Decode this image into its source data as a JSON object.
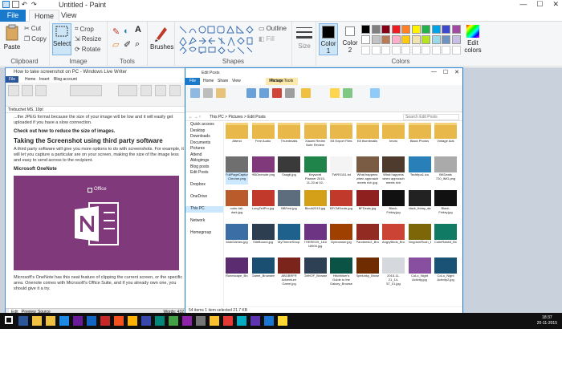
{
  "paint": {
    "title": "Untitled - Paint",
    "tabs": {
      "file": "File",
      "home": "Home",
      "view": "View"
    },
    "clipboard": {
      "paste": "Paste",
      "cut": "Cut",
      "copy": "Copy",
      "label": "Clipboard"
    },
    "image": {
      "select": "Select",
      "crop": "Crop",
      "resize": "Resize",
      "rotate": "Rotate",
      "label": "Image"
    },
    "tools": {
      "label": "Tools",
      "text_glyph": "A"
    },
    "brushes": {
      "label": "Brushes"
    },
    "shapes": {
      "outline": "Outline",
      "fill": "Fill",
      "label": "Shapes"
    },
    "size": {
      "label": "Size"
    },
    "colors": {
      "color1": "Color 1",
      "color2": "Color 2",
      "label": "Colors",
      "edit": "Edit colors",
      "palette": [
        "#000000",
        "#7f7f7f",
        "#880015",
        "#ed1c24",
        "#ff7f27",
        "#fff200",
        "#22b14c",
        "#00a2e8",
        "#3f48cc",
        "#a349a4",
        "#ffffff",
        "#c3c3c3",
        "#b97a57",
        "#ffaec9",
        "#ffc90e",
        "#efe4b0",
        "#b5e61d",
        "#99d9ea",
        "#7092be",
        "#c8bfe7"
      ]
    }
  },
  "doc": {
    "title": "How to take screenshot on PC - Windows Live Writer",
    "tabs": {
      "file": "File",
      "home": "Home",
      "insert": "Insert",
      "blog": "Blog account"
    },
    "font_bar": "Trebuchet MS, 10pt",
    "para1": "...the JPEG format because the size of your image will be low and it will easily get uploaded if you have a slow connection.",
    "link": "Check out how to reduce the size of images.",
    "heading": "Taking the Screenshot using third party software",
    "para2": "A third party software will give you more options to do with screenshots. For example, it will let you capture a particular are on your screen, making the size of the image less and easy to send across to the recipient.",
    "subheading": "Microsoft OneNote",
    "office_logo": "Office",
    "para3": "Microsoft's OneNote has this neat feature of clipping the current screen, or the specific area. Onenote comes with Microsoft's Office Suite, and if you already own one, you should give it a try.",
    "status_tabs": [
      "Edit",
      "Preview",
      "Source"
    ],
    "words": "Words: 432"
  },
  "explorer": {
    "title": "Edit Posts",
    "tabs": {
      "file": "File",
      "home": "Home",
      "share": "Share",
      "view": "View",
      "manage": "Manage",
      "picture_tools": "Picture Tools"
    },
    "address": "This PC  >  Pictures  >  Edit Posts",
    "search": "Search Edit Posts",
    "nav": [
      "Quick access",
      "Desktop",
      "Downloads",
      "Documents",
      "Pictures",
      "Attend",
      "Ablogimgs",
      "Blog posts",
      "Edit Posts",
      "",
      "Dropbox",
      "",
      "OneDrive",
      "",
      "This PC",
      "",
      "Network",
      "",
      "Homegroup"
    ],
    "items": [
      {
        "label": "Attend",
        "color": "#e9b84a"
      },
      {
        "label": "Free Audio",
        "color": "#e9b84a"
      },
      {
        "label": "Thumbnails",
        "color": "#e9b84a"
      },
      {
        "label": "Xiaomi Redmi Note Review",
        "color": "#e9b84a"
      },
      {
        "label": "E8 Export Files",
        "color": "#e9b84a"
      },
      {
        "label": "E8 thumbnails",
        "color": "#e9b84a"
      },
      {
        "label": "Imoto",
        "color": "#e9b84a"
      },
      {
        "label": "Black Photos",
        "color": "#e9b84a"
      },
      {
        "label": "Vintage Ads",
        "color": "#e9b84a"
      },
      {
        "label": "FullPageCapture Chrome.png",
        "color": "#6f6f6f"
      },
      {
        "label": "HBOnenote.png",
        "color": "#80397b"
      },
      {
        "label": "Snagit.jpg",
        "color": "#3a3a3a"
      },
      {
        "label": "Keyword Planner 2015-11-20 at 02-26.csv",
        "color": "#1e8449"
      },
      {
        "label": "TWRS151.txt",
        "color": "#f4f4f4"
      },
      {
        "label": "What happens when approach meets rich.jpg",
        "color": "#7a5c44"
      },
      {
        "label": "What happens when approach meets rich 2.jpg",
        "color": "#4f3a2e"
      },
      {
        "label": "Techtipa1.ico",
        "color": "#2980b9"
      },
      {
        "label": "BKDeals 720_IMG.png",
        "color": "#aaaaaa"
      },
      {
        "label": "outer-fall-dark.jpg",
        "color": "#b95b2b"
      },
      {
        "label": "LongTellPro.jpg",
        "color": "#c0392b"
      },
      {
        "label": "BBFest.jpg",
        "color": "#5d6d7e"
      },
      {
        "label": "Bloob2015.jpg",
        "color": "#d4a017"
      },
      {
        "label": "BFCMDeals.jpg",
        "color": "#c0392b"
      },
      {
        "label": "BFDeals.jpg",
        "color": "#8e2020"
      },
      {
        "label": "Black-Friday.jpg",
        "color": "#111111"
      },
      {
        "label": "black_friday_deals.jpg",
        "color": "#222222"
      },
      {
        "label": "Black-Friday.jpg",
        "color": "#111111"
      },
      {
        "label": "MobGames.jpg",
        "color": "#3b6ea5"
      },
      {
        "label": "SiteBound.jpg",
        "color": "#2c3e50"
      },
      {
        "label": "MyThemeShop.jpg",
        "color": "#1f618d"
      },
      {
        "label": "THEREG5_16160 18905.jpg",
        "color": "#6c3483"
      },
      {
        "label": "Dpbrowser.jpg",
        "color": "#a04000"
      },
      {
        "label": "Pandemic2_BrowserGame.jpg",
        "color": "#922b21"
      },
      {
        "label": "AngryBirds_BrowserGame.jpg",
        "color": "#cb4335"
      },
      {
        "label": "KingdomRush_BrowserGame.jpg",
        "color": "#7d6608"
      },
      {
        "label": "CutieRabbit_BrowserGame_Featured.jpg",
        "color": "#117a65"
      },
      {
        "label": "Runescape_BrowserGame.jpg",
        "color": "#5b2c6f"
      },
      {
        "label": "Game_BrowserGame.jpg",
        "color": "#1b4f72"
      },
      {
        "label": "ABGBRFR Adventure Game.jpg",
        "color": "#7b241c"
      },
      {
        "label": "GitHOF_BrowserGame.png",
        "color": "#2e4053"
      },
      {
        "label": "Hitchhiker's Guide to the Galaxy_BrowserGame.png",
        "color": "#0b5345"
      },
      {
        "label": "Spelunky_BrowserGame.jpg",
        "color": "#6e2c00"
      },
      {
        "label": "2015-11-21_14-57_01.jpg",
        "color": "#d5d8dc"
      },
      {
        "label": "CoLo_Night Activity.jpg",
        "color": "#884ea0"
      },
      {
        "label": "CoLo_Night Activity2.jpg",
        "color": "#1a5276"
      }
    ],
    "status": "54 items    1 item selected  21.7 KB"
  },
  "taskbar": {
    "icons": [
      "#ffffff",
      "#2b579a",
      "#f0c040",
      "#f0c040",
      "#1e88e5",
      "#6a1b9a",
      "#1565c0",
      "#c62828",
      "#f4511e",
      "#ffb300",
      "#3949ab",
      "#00897b",
      "#43a047",
      "#8e24aa",
      "#757575",
      "#fbc02d",
      "#e53935",
      "#00acc1",
      "#5e35b1",
      "#1976d2",
      "#fdd835"
    ],
    "time": "18:37",
    "date": "20-11-2015"
  }
}
